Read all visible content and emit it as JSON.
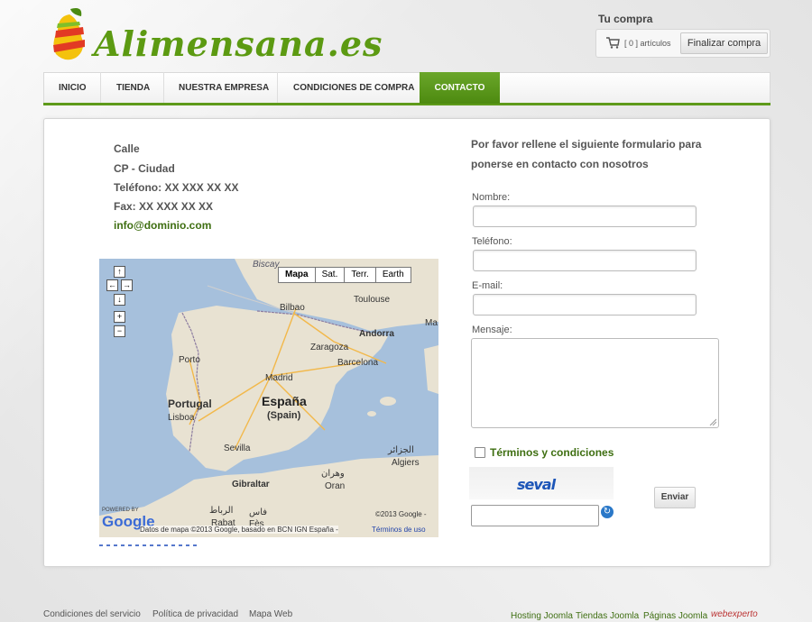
{
  "brand": {
    "name": "Alimensana.es"
  },
  "cart": {
    "title": "Tu compra",
    "count": "[ 0 ] artículos",
    "checkout": "Finalizar compra"
  },
  "nav": {
    "items": [
      "INICIO",
      "TIENDA",
      "NUESTRA EMPRESA",
      "CONDICIONES DE COMPRA",
      "CONTACTO"
    ],
    "active": "CONTACTO"
  },
  "contact": {
    "street": "Calle",
    "city": "CP - Ciudad",
    "phone": "Teléfono: XX XXX XX XX",
    "fax": "Fax: XX XXX XX XX",
    "email": "info@dominio.com"
  },
  "map": {
    "types": [
      "Mapa",
      "Sat.",
      "Terr.",
      "Earth"
    ],
    "selected_type": "Mapa",
    "controls": {
      "up": "↑",
      "left": "←",
      "right": "→",
      "down": "↓",
      "zoom_in": "+",
      "zoom_out": "−"
    },
    "labels": {
      "biscay": "Biscay",
      "toulouse": "Toulouse",
      "bilbao": "Bilbao",
      "andorra": "Andorra",
      "zaragoza": "Zaragoza",
      "barcelona": "Barcelona",
      "porto": "Porto",
      "madrid": "Madrid",
      "portugal": "Portugal",
      "espana": "España",
      "spain": "(Spain)",
      "lisboa": "Lisboa",
      "sevilla": "Sevilla",
      "alger_ar": "الجزائر",
      "algiers": "Algiers",
      "oran_ar": "وهران",
      "oran": "Oran",
      "gibraltar": "Gibraltar",
      "rabat_ar": "الرباط",
      "rabat": "Rabat",
      "fes_ar": "فاس",
      "fes": "Fès",
      "ma": "Ma"
    },
    "powered": "POWERED BY",
    "google": "Google",
    "copyright": "©2013 Google -",
    "attribution": "Datos de mapa ©2013 Google, basado en BCN IGN España -",
    "terms": "Términos de uso"
  },
  "form": {
    "intro_line1": "Por favor rellene el siguiente formulario para",
    "intro_line2": "ponerse en contacto con nosotros",
    "name_label": "Nombre:",
    "phone_label": "Teléfono:",
    "email_label": "E-mail:",
    "message_label": "Mensaje:",
    "terms": "Términos y condiciones",
    "captcha": "seval",
    "send": "Enviar"
  },
  "footer": {
    "left": [
      "Condiciones del servicio",
      "Política de privacidad",
      "Mapa Web"
    ],
    "right": [
      "Hosting Joomla",
      "Tiendas Joomla",
      "Páginas Joomla"
    ],
    "credit": "webexperto"
  },
  "colors": {
    "accent": "#5e9a1a",
    "link": "#3f6f12",
    "sea": "#a6c0dc",
    "land": "#e8e2d2"
  }
}
